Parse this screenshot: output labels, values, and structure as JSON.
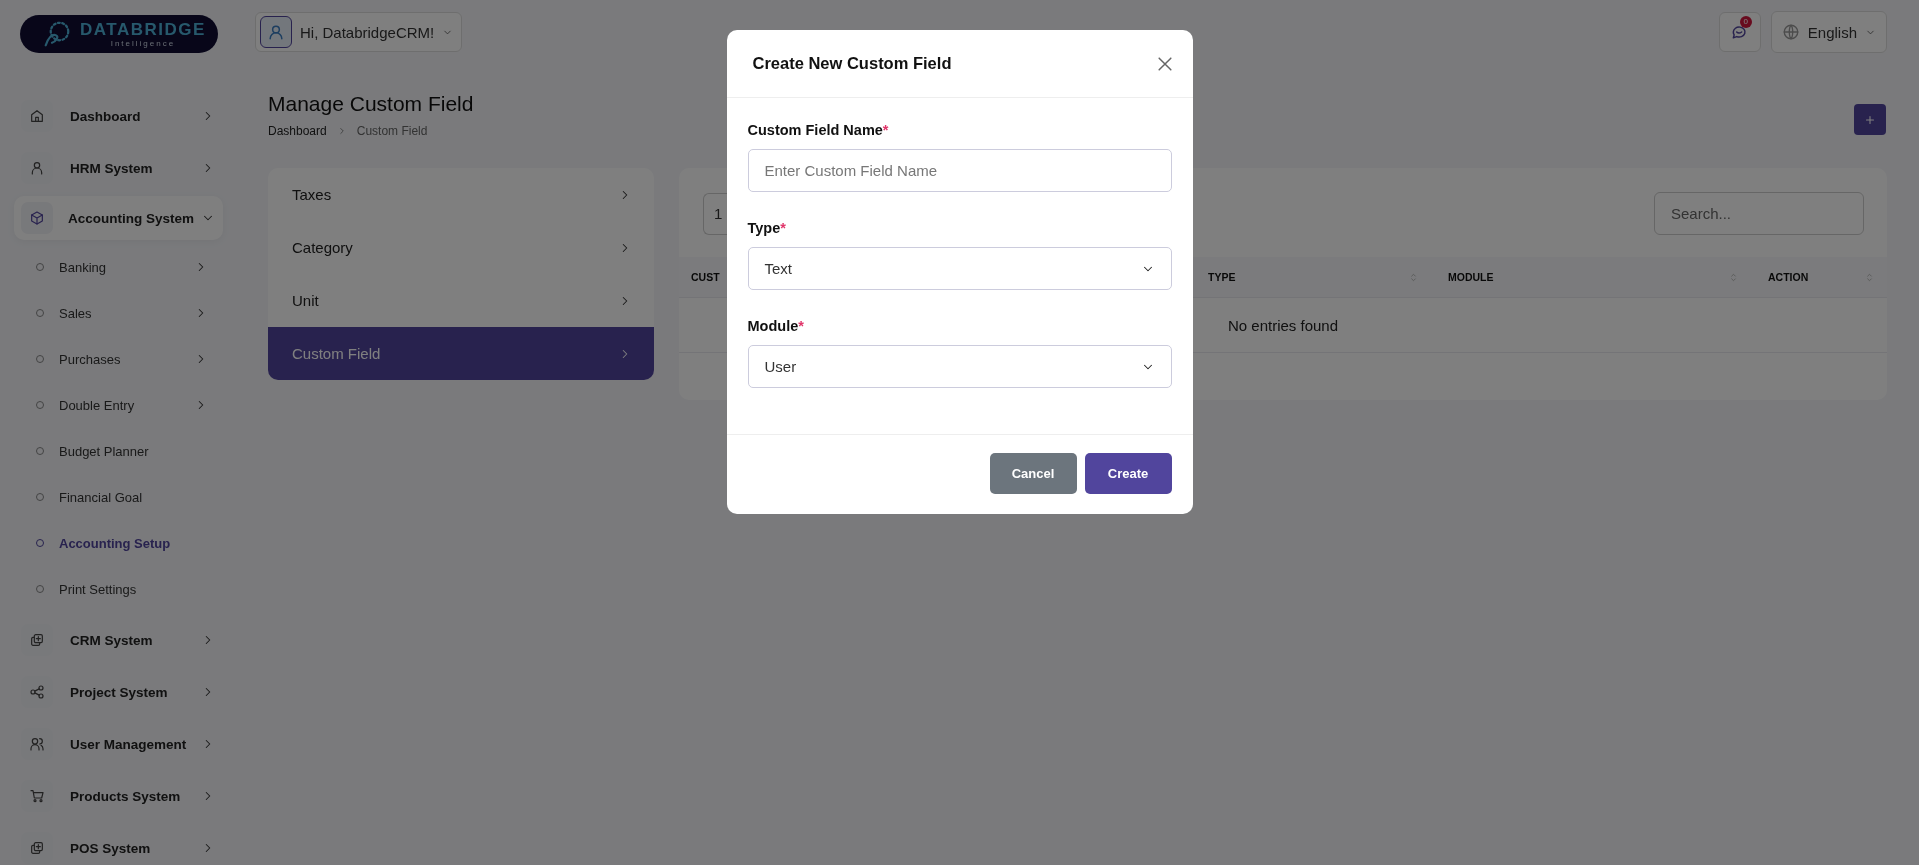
{
  "logo": {
    "name": "DATABRIDGE",
    "tagline": "Intelligence"
  },
  "header": {
    "greeting": "Hi, DatabridgeCRM!",
    "notification_count": "0",
    "language": "English"
  },
  "sidebar": {
    "items": [
      {
        "label": "Dashboard",
        "expanded": false
      },
      {
        "label": "HRM System",
        "expanded": false
      },
      {
        "label": "Accounting System",
        "expanded": true,
        "children": [
          {
            "label": "Banking",
            "kind": "group",
            "selected": false
          },
          {
            "label": "Sales",
            "kind": "group",
            "selected": false
          },
          {
            "label": "Purchases",
            "kind": "group",
            "selected": false
          },
          {
            "label": "Double Entry",
            "kind": "group",
            "selected": false
          },
          {
            "label": "Budget Planner",
            "kind": "link",
            "selected": false
          },
          {
            "label": "Financial Goal",
            "kind": "link",
            "selected": false
          },
          {
            "label": "Accounting Setup",
            "kind": "link",
            "selected": true
          },
          {
            "label": "Print Settings",
            "kind": "link",
            "selected": false
          }
        ]
      },
      {
        "label": "CRM System",
        "expanded": false
      },
      {
        "label": "Project System",
        "expanded": false
      },
      {
        "label": "User Management",
        "expanded": false
      },
      {
        "label": "Products System",
        "expanded": false
      },
      {
        "label": "POS System",
        "expanded": false
      }
    ]
  },
  "page": {
    "title": "Manage Custom Field",
    "breadcrumb": [
      "Dashboard",
      "Custom Field"
    ]
  },
  "settings_menu": {
    "items": [
      {
        "label": "Taxes",
        "selected": false
      },
      {
        "label": "Category",
        "selected": false
      },
      {
        "label": "Unit",
        "selected": false
      },
      {
        "label": "Custom Field",
        "selected": true
      }
    ]
  },
  "table": {
    "entries_select": "1",
    "search_placeholder": "Search...",
    "columns": [
      "CUST",
      "TYPE",
      "MODULE",
      "ACTION"
    ],
    "empty_message": "No entries found"
  },
  "modal": {
    "title": "Create New Custom Field",
    "fields": [
      {
        "kind": "input",
        "label": "Custom Field Name",
        "required_mark": "*",
        "placeholder": "Enter Custom Field Name"
      },
      {
        "kind": "select",
        "label": "Type",
        "required_mark": "*",
        "value": "Text"
      },
      {
        "kind": "select",
        "label": "Module",
        "required_mark": "*",
        "value": "User"
      }
    ],
    "buttons": [
      {
        "label": "Cancel",
        "kind": "secondary"
      },
      {
        "label": "Create",
        "kind": "primary"
      }
    ]
  }
}
